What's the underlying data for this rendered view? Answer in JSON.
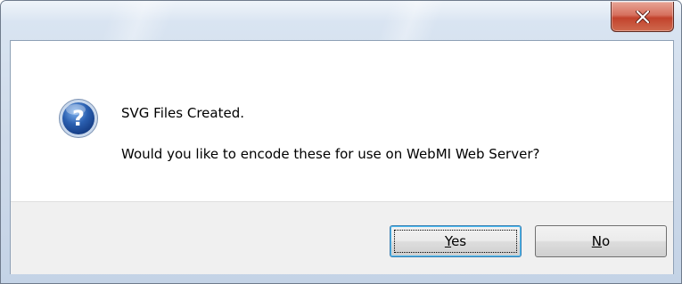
{
  "dialog": {
    "close_icon": "close-icon",
    "icon": "question-icon",
    "message_line1": "SVG Files Created.",
    "message_line2": "Would you like to encode these for use on WebMI Web Server?"
  },
  "buttons": {
    "yes": {
      "mnemonic": "Y",
      "rest": "es"
    },
    "no": {
      "mnemonic": "N",
      "rest": "o"
    }
  },
  "colors": {
    "close_button": "#c2422c",
    "icon_blue": "#2a5fb0",
    "focus_border": "#3c7fb1"
  }
}
